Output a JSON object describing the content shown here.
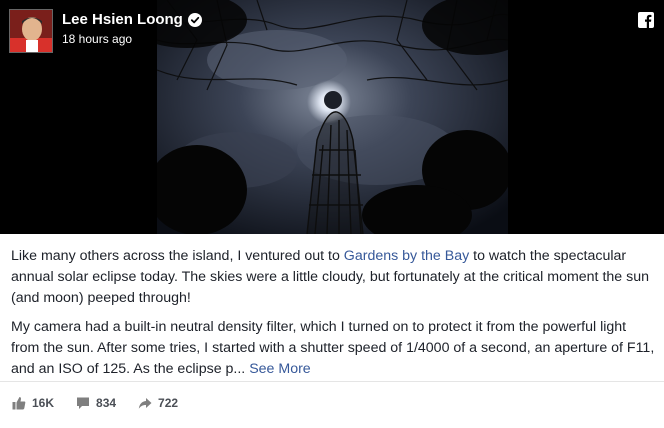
{
  "post": {
    "author": "Lee Hsien Loong",
    "timestamp": "18 hours ago",
    "paragraph1": {
      "before_link": "Like many others across the island, I ventured out to ",
      "link": "Gardens by the Bay",
      "after_link": " to watch the spectacular annual solar eclipse today. The skies were a little cloudy, but fortunately at the critical moment the sun (and moon) peeped through!"
    },
    "paragraph2": {
      "text": "My camera had a built-in neutral density filter, which I turned on to protect it from the powerful light from the sun. After some tries, I started with a shutter speed of 1/4000 of a second, an aperture of F11, and an ISO of 125. As the eclipse p... ",
      "see_more": "See More"
    }
  },
  "stats": {
    "likes": "16K",
    "comments": "834",
    "shares": "722"
  },
  "icons": {
    "verified": "verified-badge-icon",
    "brand": "facebook-logo-icon",
    "like": "thumbs-up-icon",
    "comment": "comment-bubble-icon",
    "share": "share-arrow-icon"
  },
  "colors": {
    "link": "#365899",
    "text": "#1d2129",
    "meta": "#4b4f56",
    "media_bg": "#000000"
  }
}
